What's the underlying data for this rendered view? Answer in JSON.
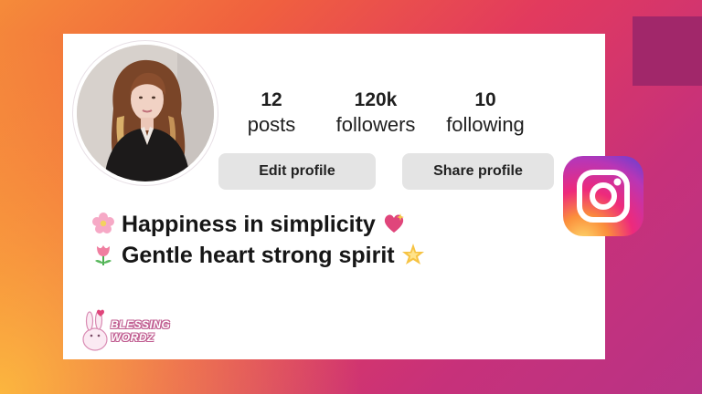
{
  "profile": {
    "stats": [
      {
        "value": "12",
        "label": "posts"
      },
      {
        "value": "120k",
        "label": "followers"
      },
      {
        "value": "10",
        "label": "following"
      }
    ],
    "buttons": {
      "edit": "Edit profile",
      "share": "Share profile"
    },
    "bio": [
      {
        "icon": "cherry-blossom-icon",
        "text": "Happiness in simplicity",
        "end_icon": "sparkling-heart-icon"
      },
      {
        "icon": "tulip-icon",
        "text": "Gentle heart strong spirit",
        "end_icon": "glowing-star-icon"
      }
    ]
  },
  "branding": {
    "platform_logo": "instagram-logo-icon",
    "watermark": "BLESSING WORDZ"
  },
  "colors": {
    "accent_pink": "#e0457b",
    "button_bg": "#e4e4e4",
    "corner_square": "#a1276a"
  }
}
